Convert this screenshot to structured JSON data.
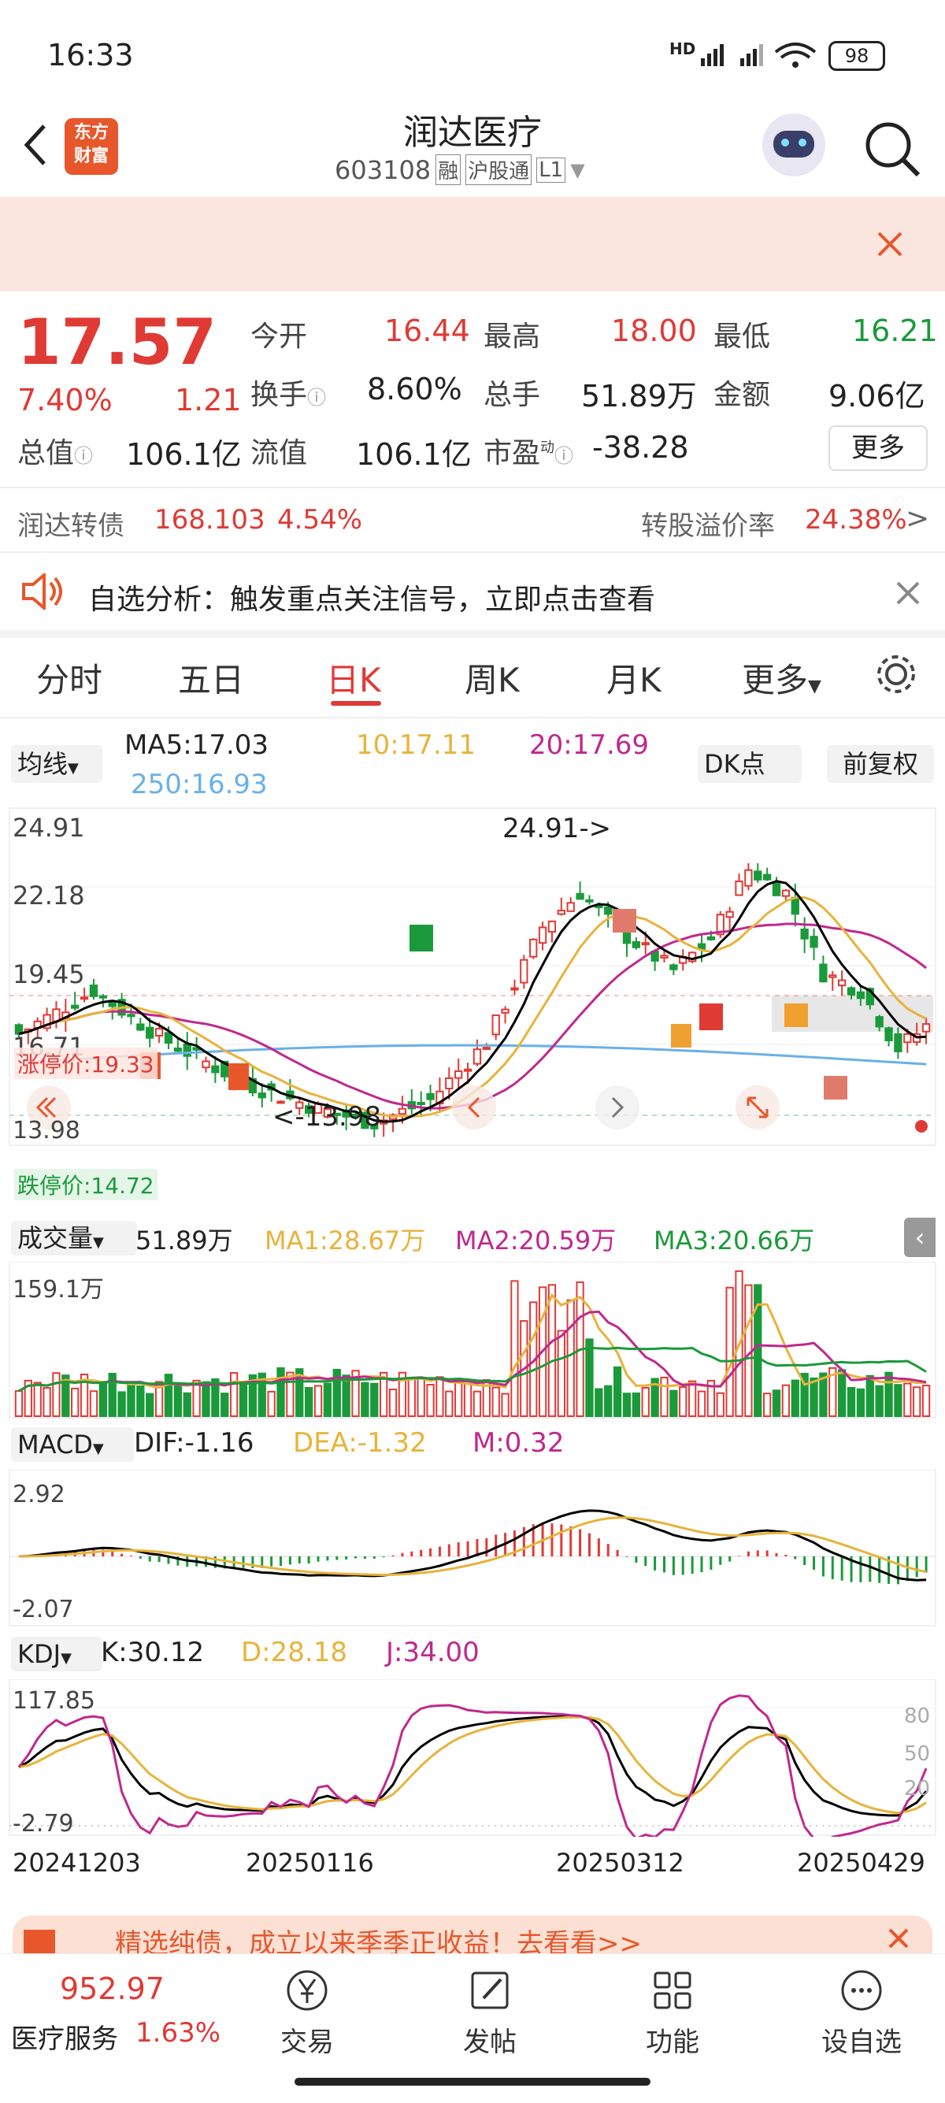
{
  "status": {
    "time": "16:33",
    "signal_tag": "HD",
    "battery": "98"
  },
  "header": {
    "logo_line1": "东方",
    "logo_line2": "财富",
    "name": "润达医疗",
    "code": "603108",
    "badge1": "融",
    "badge2": "沪股通",
    "badge3": "L1"
  },
  "quote": {
    "price": "17.57",
    "pct": "7.40%",
    "chg": "1.21",
    "open_label": "今开",
    "open": "16.44",
    "high_label": "最高",
    "high": "18.00",
    "low_label": "最低",
    "low": "16.21",
    "turnover_label": "换手",
    "turnover": "8.60%",
    "volume_label": "总手",
    "volume": "51.89万",
    "amount_label": "金额",
    "amount": "9.06亿",
    "mcap_label": "总值",
    "mcap": "106.1亿",
    "float_label": "流值",
    "float": "106.1亿",
    "pe_label": "市盈",
    "pe_sup": "动",
    "pe": "-38.28",
    "more": "更多"
  },
  "bond": {
    "name": "润达转债",
    "price": "168.103",
    "pct": "4.54%",
    "premium_label": "转股溢价率",
    "premium": "24.38%"
  },
  "notice": {
    "text": "自选分析：触发重点关注信号，立即点击查看"
  },
  "tabs": [
    "分时",
    "五日",
    "日K",
    "周K",
    "月K",
    "更多"
  ],
  "active_tab": "日K",
  "ma_bar": {
    "selector": "均线",
    "ma5": "MA5:17.03",
    "ma10": "10:17.11",
    "ma20": "20:17.69",
    "ma250": "250:16.93",
    "dk": "DK点",
    "fq": "前复权"
  },
  "kline": {
    "y_top": "24.91",
    "y2": "22.18",
    "y3": "19.45",
    "y4": "16.71",
    "y_bottom": "13.98",
    "high_tag": "24.91->",
    "low_tag": "<-13.98",
    "zt": "涨停价:19.33",
    "dt": "跌停价:14.72"
  },
  "volume_bar": {
    "selector": "成交量",
    "vol": "51.89万",
    "ma1": "MA1:28.67万",
    "ma2": "MA2:20.59万",
    "ma3": "MA3:20.66万",
    "top": "159.1万"
  },
  "macd_bar": {
    "selector": "MACD",
    "dif": "DIF:-1.16",
    "dea": "DEA:-1.32",
    "m": "M:0.32",
    "top": "2.92",
    "bottom": "-2.07"
  },
  "kdj_bar": {
    "selector": "KDJ",
    "k": "K:30.12",
    "d": "D:28.18",
    "j": "J:34.00",
    "top": "117.85",
    "bottom": "-2.79",
    "l80": "80",
    "l50": "50",
    "l20": "20"
  },
  "dates": [
    "20241203",
    "20250116",
    "20250312",
    "20250429"
  ],
  "promo": {
    "text": "精选纯债，成立以来季季正收益！去看看>>"
  },
  "bottom": {
    "index_value": "952.97",
    "index_name": "医疗服务",
    "index_pct": "1.63%",
    "trade": "交易",
    "post": "发帖",
    "func": "功能",
    "watch": "设自选"
  },
  "colors": {
    "up": "#e03a35",
    "down": "#1a9a3a",
    "ma5": "#000000",
    "ma10": "#e8b33a",
    "ma20": "#c0288e",
    "ma250": "#6ab0e8"
  }
}
